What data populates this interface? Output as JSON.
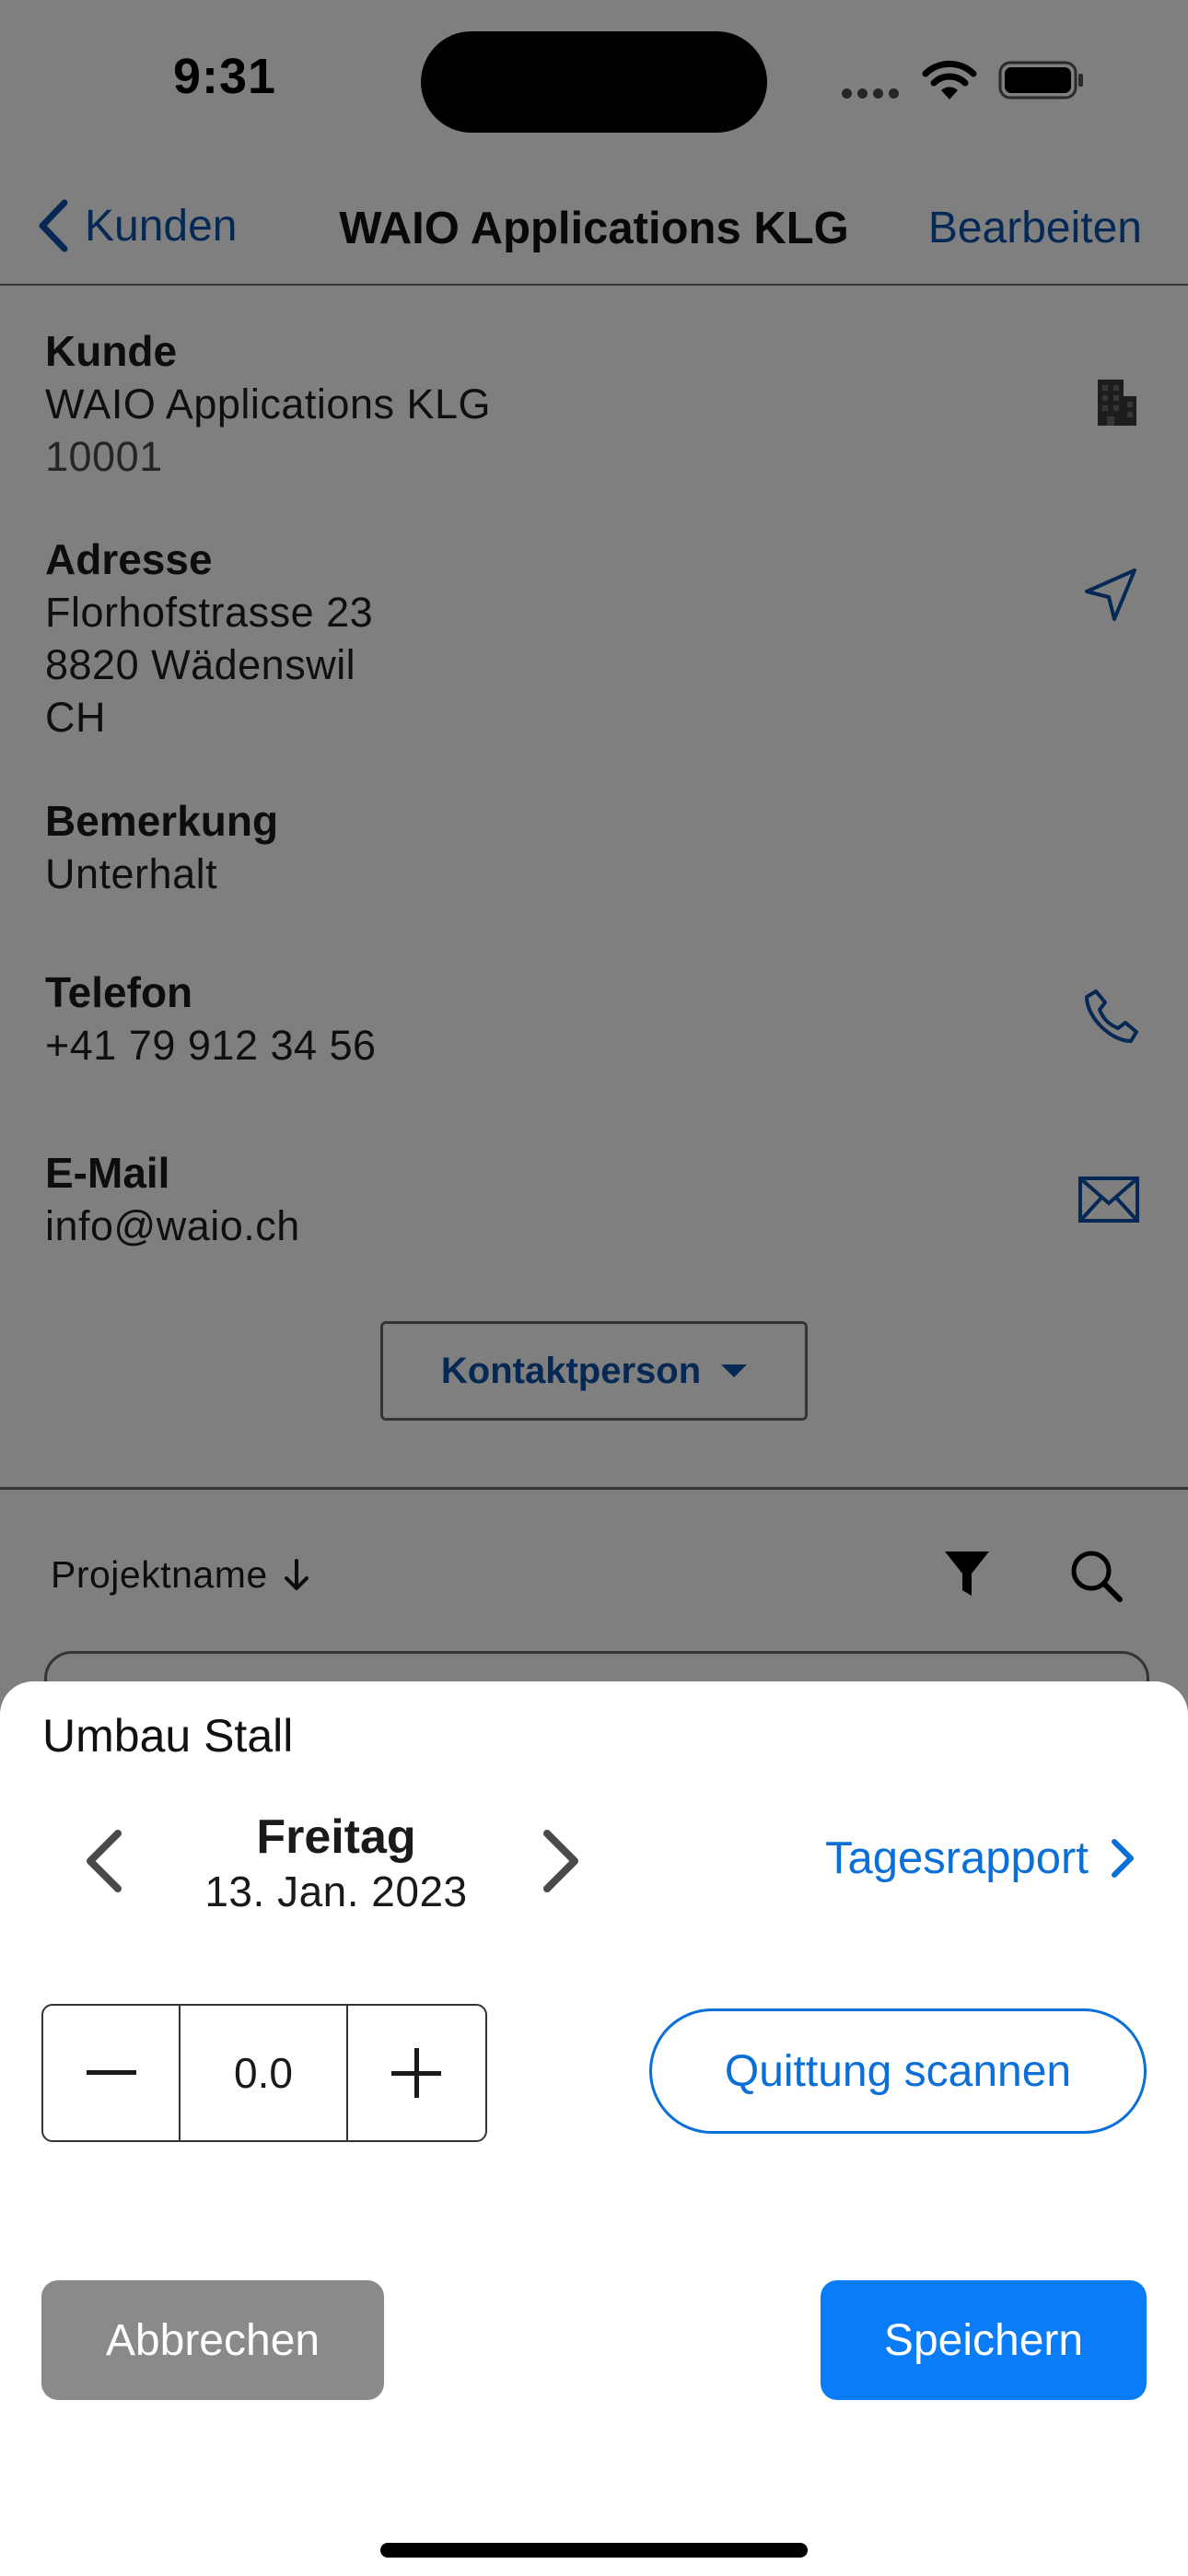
{
  "status_bar": {
    "time": "9:31"
  },
  "nav": {
    "back_label": "Kunden",
    "title": "WAIO Applications KLG",
    "edit_label": "Bearbeiten"
  },
  "details": {
    "customer": {
      "label": "Kunde",
      "name": "WAIO Applications KLG",
      "number": "10001",
      "icon": "building-icon"
    },
    "address": {
      "label": "Adresse",
      "street": "Florhofstrasse 23",
      "city": "8820 Wädenswil",
      "country": "CH",
      "icon": "navigation-arrow-icon"
    },
    "remark": {
      "label": "Bemerkung",
      "value": "Unterhalt"
    },
    "phone": {
      "label": "Telefon",
      "value": "+41 79 912 34 56",
      "icon": "phone-icon"
    },
    "email": {
      "label": "E-Mail",
      "value": "info@waio.ch",
      "icon": "envelope-icon"
    },
    "contact_button": "Kontaktperson"
  },
  "list_header": {
    "sort_label": "Projektname",
    "filter_icon": "filter-icon",
    "search_icon": "search-icon"
  },
  "sheet": {
    "title": "Umbau Stall",
    "day_name": "Freitag",
    "date": "13. Jan. 2023",
    "report_link": "Tagesrapport",
    "stepper_value": "0.0",
    "scan_button": "Quittung scannen",
    "cancel_button": "Abbrechen",
    "save_button": "Speichern"
  },
  "colors": {
    "link_blue": "#0a6fd8",
    "primary_button": "#0a7cf7",
    "cancel_button": "#8a8a8a"
  }
}
